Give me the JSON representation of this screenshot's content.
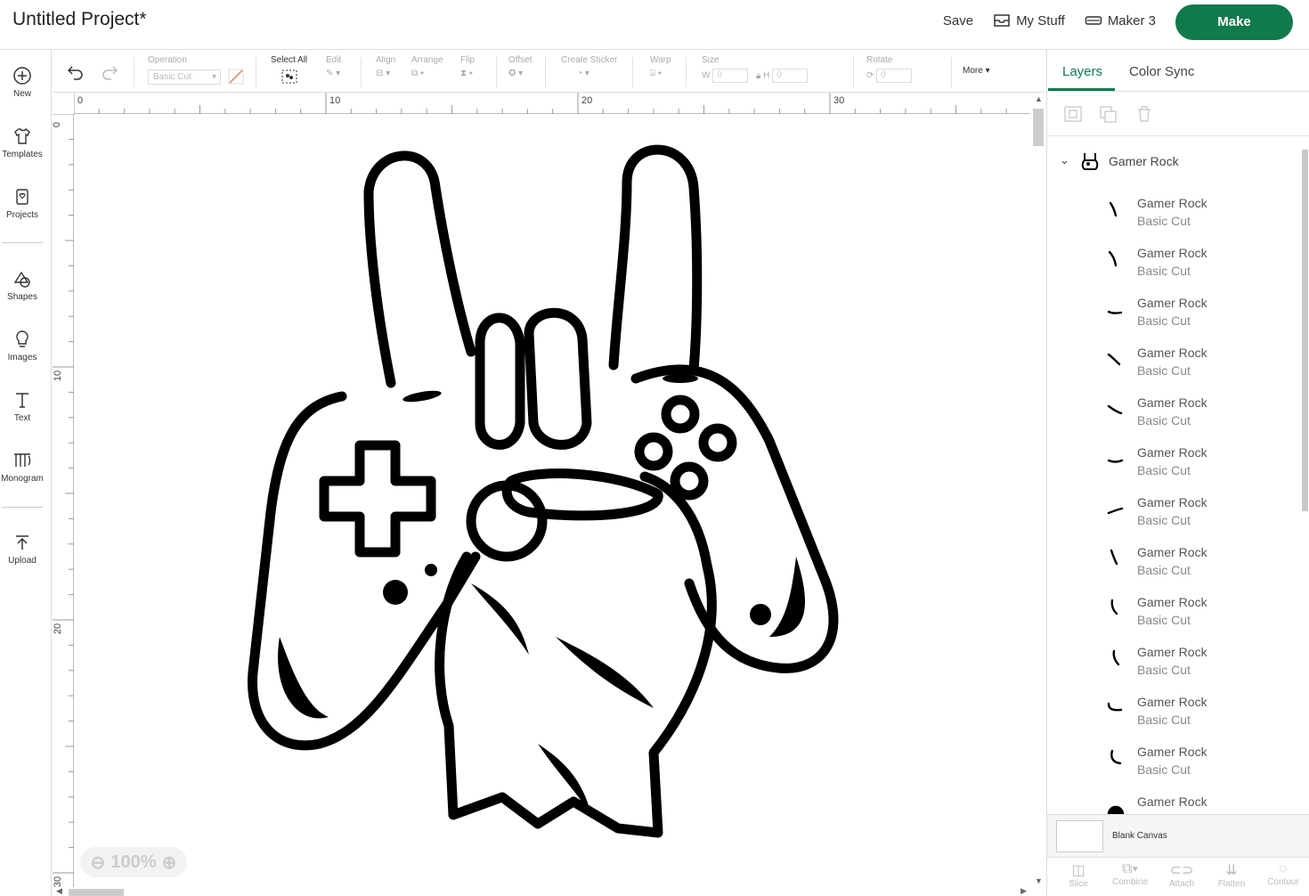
{
  "header": {
    "title": "Untitled Project*",
    "save": "Save",
    "my_stuff": "My Stuff",
    "machine": "Maker 3",
    "make": "Make"
  },
  "leftbar": {
    "items": [
      {
        "label": "New",
        "icon": "plus-circle-icon"
      },
      {
        "label": "Templates",
        "icon": "shirt-icon"
      },
      {
        "label": "Projects",
        "icon": "project-icon"
      },
      {
        "label": "Shapes",
        "icon": "shapes-icon"
      },
      {
        "label": "Images",
        "icon": "lightbulb-icon"
      },
      {
        "label": "Text",
        "icon": "text-icon"
      },
      {
        "label": "Monogram",
        "icon": "monogram-icon"
      },
      {
        "label": "Upload",
        "icon": "upload-icon"
      }
    ]
  },
  "toolbar": {
    "operation_label": "Operation",
    "operation_value": "Basic Cut",
    "select_all": "Select All",
    "edit": "Edit",
    "align": "Align",
    "arrange": "Arrange",
    "flip": "Flip",
    "offset": "Offset",
    "create_sticker": "Create Sticker",
    "warp": "Warp",
    "size": "Size",
    "w_label": "W",
    "w_value": "0",
    "h_label": "H",
    "h_value": "0",
    "rotate": "Rotate",
    "rotate_value": "0",
    "more": "More"
  },
  "canvas": {
    "ruler_top": [
      "0",
      "10",
      "20",
      "30"
    ],
    "ruler_left": [
      "0",
      "10",
      "20",
      "30"
    ],
    "zoom": "100%"
  },
  "panel": {
    "tab_layers": "Layers",
    "tab_color_sync": "Color Sync",
    "group_name": "Gamer Rock",
    "layers": [
      {
        "name": "Gamer Rock",
        "op": "Basic Cut"
      },
      {
        "name": "Gamer Rock",
        "op": "Basic Cut"
      },
      {
        "name": "Gamer Rock",
        "op": "Basic Cut"
      },
      {
        "name": "Gamer Rock",
        "op": "Basic Cut"
      },
      {
        "name": "Gamer Rock",
        "op": "Basic Cut"
      },
      {
        "name": "Gamer Rock",
        "op": "Basic Cut"
      },
      {
        "name": "Gamer Rock",
        "op": "Basic Cut"
      },
      {
        "name": "Gamer Rock",
        "op": "Basic Cut"
      },
      {
        "name": "Gamer Rock",
        "op": "Basic Cut"
      },
      {
        "name": "Gamer Rock",
        "op": "Basic Cut"
      },
      {
        "name": "Gamer Rock",
        "op": "Basic Cut"
      },
      {
        "name": "Gamer Rock",
        "op": "Basic Cut"
      },
      {
        "name": "Gamer Rock",
        "op": ""
      }
    ],
    "blank_canvas": "Blank Canvas",
    "bottom_tools": [
      "Slice",
      "Combine",
      "Attach",
      "Flatten",
      "Contour"
    ]
  },
  "colors": {
    "accent": "#0f7a4c"
  }
}
